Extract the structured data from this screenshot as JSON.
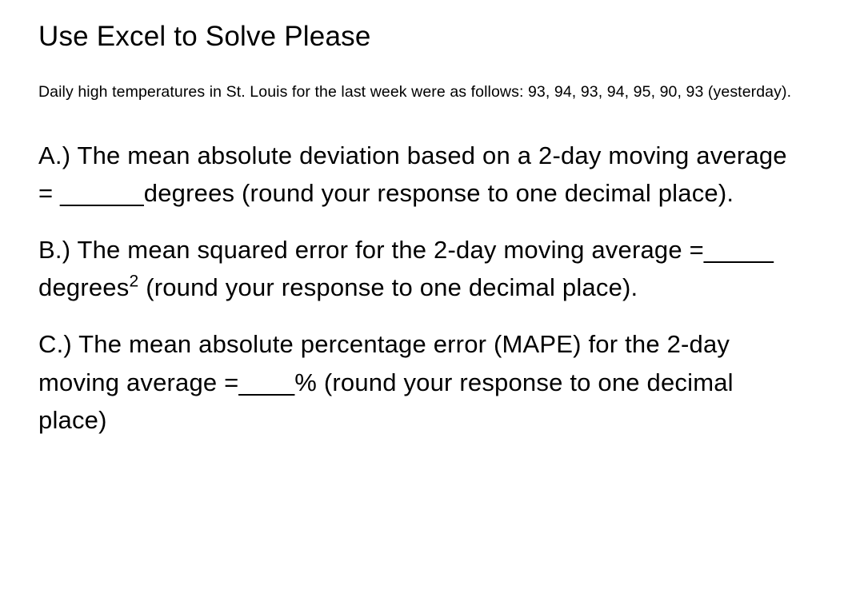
{
  "title": "Use Excel to Solve Please",
  "subheading": "Daily high temperatures in St. Louis for the last week were as follows: 93, 94, 93, 94, 95, 90, 93 (yesterday).",
  "questions": {
    "a": {
      "prefix": "A.) The mean absolute deviation based on a 2-day moving average = ",
      "blank": "______",
      "suffix": "degrees (round your response to one decimal place)."
    },
    "b": {
      "prefix": "B.) The mean squared error for the 2-day moving average =",
      "blank": "_____",
      "unit_base": " degrees",
      "unit_exp": "2",
      "suffix": " (round your response to one decimal place)."
    },
    "c": {
      "prefix": "C.) The mean absolute percentage error (MAPE) for the 2-day moving average =",
      "blank": "____",
      "suffix": "% (round your response to one decimal place)"
    }
  }
}
